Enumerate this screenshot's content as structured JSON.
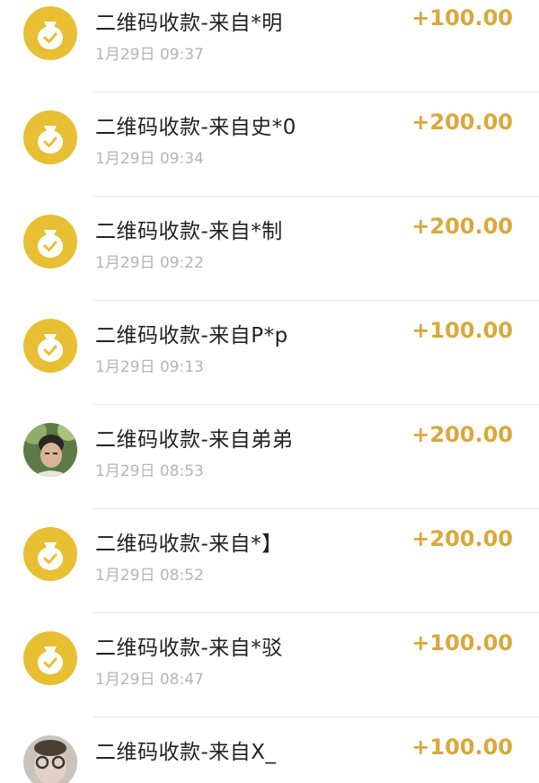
{
  "transactions": [
    {
      "title": "二维码收款-来自*明",
      "time": "1月29日 09:37",
      "amount": "+100.00",
      "avatar": "coin-bag-icon"
    },
    {
      "title": "二维码收款-来自史*0",
      "time": "1月29日 09:34",
      "amount": "+200.00",
      "avatar": "coin-bag-icon"
    },
    {
      "title": "二维码收款-来自*制",
      "time": "1月29日 09:22",
      "amount": "+200.00",
      "avatar": "coin-bag-icon"
    },
    {
      "title": "二维码收款-来自P*p",
      "time": "1月29日 09:13",
      "amount": "+100.00",
      "avatar": "coin-bag-icon"
    },
    {
      "title": "二维码收款-来自弟弟",
      "time": "1月29日 08:53",
      "amount": "+200.00",
      "avatar": "user-photo"
    },
    {
      "title": "二维码收款-来自*】",
      "time": "1月29日 08:52",
      "amount": "+200.00",
      "avatar": "coin-bag-icon"
    },
    {
      "title": "二维码收款-来自*驳",
      "time": "1月29日 08:47",
      "amount": "+100.00",
      "avatar": "coin-bag-icon"
    },
    {
      "title": "二维码收款-来自X_",
      "time": "",
      "amount": "+100.00",
      "avatar": "user-photo"
    }
  ],
  "colors": {
    "coin": "#e8bf33",
    "amount": "#d9a83c",
    "title": "#222222",
    "time": "#b5b5b5"
  }
}
